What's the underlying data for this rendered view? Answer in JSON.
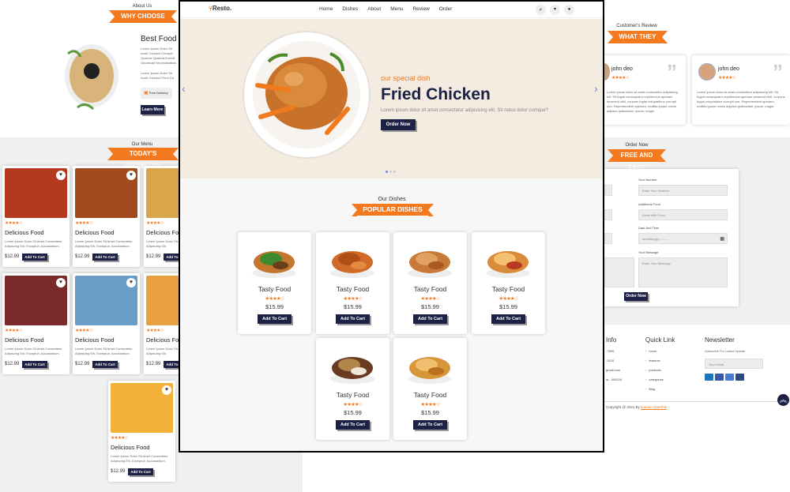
{
  "background_page": {
    "about": {
      "small_title": "About Us",
      "ribbon": "WHY CHOOSE US?",
      "heading": "Best Food In",
      "para1": "Lorem Ipsum Dolor Sit Amet Consect Corrupti Quaerat Quaerat Exercit Obcaecati Necessitatibus Dolores Culpa Ut Maxima",
      "para2": "Lorem Ipsum Dolor Sit Amet Consect Porro Ea Cur Cumque Delectus",
      "badge": "Free Delivery",
      "button": "Learn More"
    },
    "menu": {
      "small_title": "Our Menu",
      "ribbon": "TODAY'S SPECIALITY",
      "items": [
        {
          "title": "Delicious Food",
          "desc": "Lorem Ipsum Dolor Sit Amet Consectetur Adipiscing Elit. Excepturi, Accusantium.",
          "price": "$12.99",
          "button": "Add To Cart",
          "stars": "★★★★☆"
        },
        {
          "title": "Delicious Food",
          "desc": "Lorem Ipsum Dolor Sit Amet Consectetur Adipiscing Elit. Excepturi, Accusantium.",
          "price": "$12.99",
          "button": "Add To Cart",
          "stars": "★★★★☆"
        },
        {
          "title": "Delicious Food",
          "desc": "Lorem Ipsum Dolor Sit Amet Consectetur Adipiscing Elit.",
          "price": "$12.99",
          "button": "Add To Cart",
          "stars": "★★★★☆"
        },
        {
          "title": "Delicious Food",
          "desc": "Lorem Ipsum Dolor Sit Amet Consectetur Adipiscing Elit. Excepturi, Accusantium.",
          "price": "$12.99",
          "button": "Add To Cart",
          "stars": "★★★★☆"
        },
        {
          "title": "Delicious Food",
          "desc": "Lorem Ipsum Dolor Sit Amet Consectetur Adipiscing Elit. Excepturi, Accusantium.",
          "price": "$12.99",
          "button": "Add To Cart",
          "stars": "★★★★☆"
        },
        {
          "title": "Delicious Food",
          "desc": "Lorem Ipsum Dolor Sit Amet Consectetur Adipiscing Elit.",
          "price": "$12.99",
          "button": "Add To Cart",
          "stars": "★★★★☆"
        },
        {
          "title": "Delicious Food",
          "desc": "Lorem Ipsum Dolor Sit Amet Consectetur Adipiscing Elit. Excepturi, Accusantium.",
          "price": "$12.99",
          "button": "Add To Cart",
          "stars": "★★★★☆"
        }
      ]
    },
    "review": {
      "small_title": "Customer's Review",
      "ribbon": "WHAT THEY SAY",
      "cards": [
        {
          "name": "john deo",
          "stars": "★★★★☆",
          "text": "Lorem ipsum dolor sit amet consectetur adipisicing elit. Sit fugiat consequatur repellendus aperiam deserunt nihil, corporis fugiat voluptatibus corrupti iure. Reprehenderit aperiam, mollitia ipsam omnis adipisci quibusdam, ipsum, magni."
        },
        {
          "name": "john deo",
          "stars": "★★★★☆",
          "text": "Lorem ipsum dolor sit amet consectetur adipisicing elit. Sit fugiat consequatur repellendus aperiam deserunt nihil, corporis fugiat voluptatibus corrupti iure. Reprehenderit aperiam, mollitia ipsam omnis adipisci quibusdam, ipsum, magni."
        }
      ]
    },
    "order": {
      "small_title": "Order Now",
      "ribbon": "FREE AND FAST",
      "your_number_label": "Your Number",
      "your_number_placeholder": "Enter Your Number",
      "additional_food_label": "Additional Food",
      "additional_food_placeholder": "Extra With Food",
      "date_label": "Date And Time",
      "date_placeholder": "mm/dd/yyyy --:-- --",
      "message_label": "Your Message",
      "message_placeholder": "Enter Your Message",
      "button": "Order Now"
    },
    "footer": {
      "contact_heading": "Info",
      "contact_items": [
        "-7890",
        "-3210",
        "gmail.com",
        "ia - 400104"
      ],
      "quick_heading": "Quick Link",
      "quick_items": [
        "home",
        "features",
        "products",
        "categories",
        "Blog"
      ],
      "news_heading": "Newsletter",
      "news_text": "Subscribe For Latest Update",
      "news_placeholder": "Your Email",
      "copyright_prefix": "Copyright @ 2021 By",
      "copyright_link": "keenan sharchik",
      "payment_icons": [
        "paypal-icon",
        "visa-icon",
        "mastercard-icon",
        "amex-icon"
      ]
    }
  },
  "window": {
    "nav": {
      "logo": "Resto.",
      "links": [
        "Home",
        "Dishes",
        "About",
        "Menu",
        "Review",
        "Order"
      ]
    },
    "hero": {
      "subtitle": "our special dish",
      "title": "Fried Chicken",
      "text": "Lorem ipsum dolor sit amet consectetur adipisicing elit. Sit natus dolor cumque?",
      "button": "Order Now",
      "dots": 3,
      "active_dot": 0
    },
    "dishes": {
      "small_title": "Our Dishes",
      "ribbon": "POPULAR DISHES",
      "items": [
        {
          "title": "Tasty Food",
          "stars": "★★★★☆",
          "price": "$15.99",
          "button": "Add To Cart",
          "icon": "burger-icon"
        },
        {
          "title": "Tasty Food",
          "stars": "★★★★☆",
          "price": "$15.99",
          "button": "Add To Cart",
          "icon": "nuggets-icon"
        },
        {
          "title": "Tasty Food",
          "stars": "★★★★☆",
          "price": "$15.99",
          "button": "Add To Cart",
          "icon": "roast-chicken-icon"
        },
        {
          "title": "Tasty Food",
          "stars": "★★★★☆",
          "price": "$15.99",
          "button": "Add To Cart",
          "icon": "pizza-icon"
        },
        {
          "title": "Tasty Food",
          "stars": "★★★★☆",
          "price": "$15.99",
          "button": "Add To Cart",
          "icon": "dessert-icon"
        },
        {
          "title": "Tasty Food",
          "stars": "★★★★☆",
          "price": "$15.99",
          "button": "Add To Cart",
          "icon": "fried-chicken-icon"
        }
      ]
    }
  },
  "colors": {
    "accent": "#f4791f",
    "dark": "#1c2145",
    "hero_bg": "#f4ebe1"
  }
}
